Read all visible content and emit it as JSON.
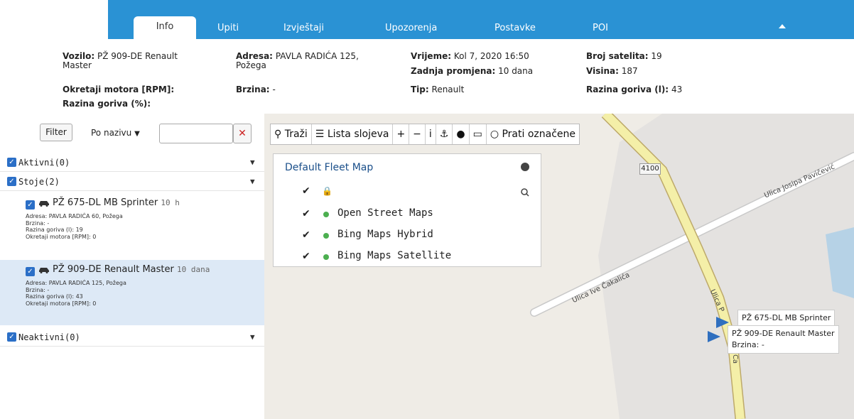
{
  "nav": {
    "tabs": [
      {
        "label": "Info",
        "active": true
      },
      {
        "label": "Upiti"
      },
      {
        "label": "Izvještaji"
      },
      {
        "label": "Upozorenja"
      },
      {
        "label": "Postavke"
      },
      {
        "label": "POI"
      }
    ],
    "accent": "#2a92d4"
  },
  "info": {
    "vozilo_label": "Vozilo:",
    "vozilo_value": "PŽ 909-DE Renault",
    "vozilo_value2": "Master",
    "adresa_label": "Adresa:",
    "adresa_value": "PAVLA RADIĆA 125,",
    "adresa_value2": "Požega",
    "vrijeme_label": "Vrijeme:",
    "vrijeme_value": "Kol 7, 2020 16:50",
    "zadnja_label": "Zadnja promjena:",
    "zadnja_value": "10 dana",
    "broj_label": "Broj satelita:",
    "broj_value": "19",
    "visina_label": "Visina:",
    "visina_value": "187",
    "okretaji_label": "Okretaji motora [RPM]:",
    "brzina_label": "Brzina:",
    "brzina_value": "-",
    "tip_label": "Tip:",
    "tip_value": "Renault",
    "razina_l_label": "Razina goriva (l):",
    "razina_l_value": "43",
    "razina_pct_label": "Razina goriva (%):"
  },
  "sidebar": {
    "filter_label": "Filter",
    "sort_label": "Po nazivu",
    "search_value": "",
    "clear_label": "✕",
    "groups": {
      "aktivni": "Aktivni(0)",
      "stoje": "Stoje(2)",
      "neaktivni": "Neaktivni(0)"
    },
    "vehicles": [
      {
        "name": "PŽ 675-DL MB Sprinter",
        "time": "10 h",
        "adresa": "Adresa: PAVLA RADIĆA 60, Požega",
        "brzina": "Brzina: -",
        "razina": "Razina goriva (l): 19",
        "okretaji": "Okretaji motora [RPM]: 0"
      },
      {
        "name": "PŽ 909-DE Renault Master",
        "time": "10 dana",
        "adresa": "Adresa: PAVLA RADIĆA 125, Požega",
        "brzina": "Brzina: -",
        "razina": "Razina goriva (l): 43",
        "okretaji": "Okretaji motora [RPM]: 0"
      }
    ]
  },
  "toolbar": {
    "search_label": "Traži",
    "layers_label": "Lista slojeva",
    "zoom_in": "+",
    "zoom_out": "−",
    "info": "i",
    "anchor": "⚓",
    "follow_label": "Prati označene"
  },
  "layers": {
    "title": "Default Fleet Map",
    "items": [
      {
        "name": "Open Street Maps"
      },
      {
        "name": "Bing Maps Hybrid"
      },
      {
        "name": "Bing Maps Satellite"
      }
    ]
  },
  "map": {
    "route_badge": "4100",
    "road_1": "Ulica Josipa Pavičević",
    "road_2": "Ulica Ive Čakalića",
    "road_3": "Ulica P",
    "road_4": "Ca",
    "label_1": "PŽ 675-DL MB Sprinter",
    "label_2_name": "PŽ 909-DE Renault Master",
    "label_2_speed": "Brzina: -"
  }
}
